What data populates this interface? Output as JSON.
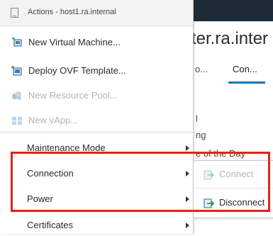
{
  "background": {
    "title_fragment": "ter.ra.inter",
    "tabs": [
      "o...",
      "Con..."
    ],
    "fragments": [
      "l",
      "ng",
      "e of the Day"
    ]
  },
  "menu": {
    "header": "Actions - host1.ra.internal",
    "items": [
      {
        "label": "New Virtual Machine...",
        "icon": "new-vm-icon",
        "disabled": false,
        "submenu": false
      },
      {
        "label": "Deploy OVF Template...",
        "icon": "deploy-ovf-icon",
        "disabled": false,
        "submenu": false
      },
      {
        "label": "New Resource Pool...",
        "icon": "resource-pool-icon",
        "disabled": true,
        "submenu": false
      },
      {
        "label": "New vApp...",
        "icon": "vapp-icon",
        "disabled": true,
        "submenu": false
      },
      {
        "label": "Maintenance Mode",
        "disabled": false,
        "submenu": true
      },
      {
        "label": "Connection",
        "disabled": false,
        "submenu": true
      },
      {
        "label": "Power",
        "disabled": false,
        "submenu": true
      },
      {
        "label": "Certificates",
        "disabled": false,
        "submenu": true
      }
    ]
  },
  "submenu": {
    "items": [
      {
        "label": "Connect",
        "icon": "connect-icon",
        "disabled": true
      },
      {
        "label": "Disconnect",
        "icon": "disconnect-icon",
        "disabled": false
      }
    ]
  },
  "colors": {
    "highlight": "#e0251b",
    "topbar": "#1d2b36",
    "tab_underline": "#0079b8",
    "disabled_text": "#b4b4b4"
  }
}
